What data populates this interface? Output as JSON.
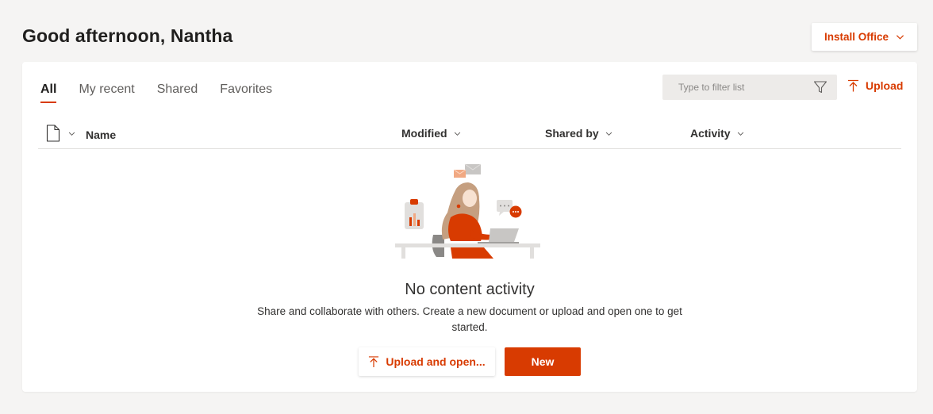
{
  "header": {
    "greeting": "Good afternoon, Nantha",
    "install_label": "Install Office"
  },
  "tabs": [
    {
      "label": "All",
      "active": true
    },
    {
      "label": "My recent",
      "active": false
    },
    {
      "label": "Shared",
      "active": false
    },
    {
      "label": "Favorites",
      "active": false
    }
  ],
  "filter": {
    "placeholder": "Type to filter list",
    "value": ""
  },
  "toolbar": {
    "upload_label": "Upload"
  },
  "columns": {
    "name": "Name",
    "modified": "Modified",
    "shared_by": "Shared by",
    "activity": "Activity"
  },
  "empty_state": {
    "title": "No content activity",
    "description": "Share and collaborate with others. Create a new document or upload and open one to get started.",
    "upload_button": "Upload and open...",
    "new_button": "New"
  },
  "colors": {
    "accent": "#d83b01",
    "background": "#f5f4f3",
    "card": "#ffffff"
  },
  "icons": [
    "chevron-down-icon",
    "filter-icon",
    "upload-icon",
    "document-icon"
  ]
}
